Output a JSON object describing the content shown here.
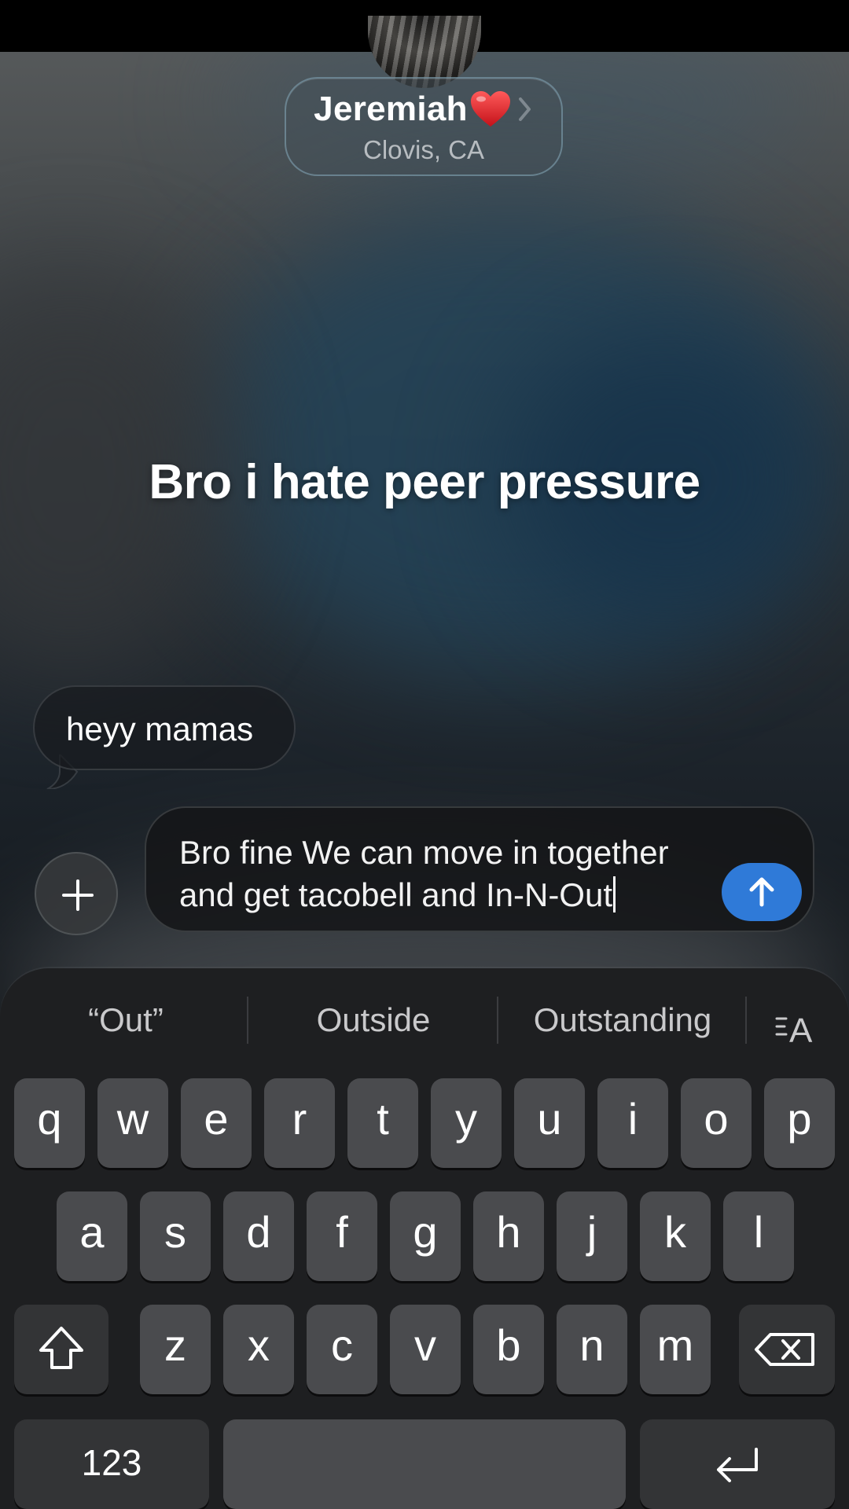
{
  "contact": {
    "name": "Jeremiah",
    "location": "Clovis, CA",
    "emoji": "heart-emoji-icon"
  },
  "conversation": {
    "effect_text": "Bro i hate peer pressure",
    "incoming_message": "heyy mamas"
  },
  "compose": {
    "line1": "Bro fine We can move in together",
    "line2": "and get tacobell and In-N-Out",
    "send_color": "#2f7ad8"
  },
  "keyboard": {
    "suggestions": [
      "“Out”",
      "Outside",
      "Outstanding"
    ],
    "row1": [
      "q",
      "w",
      "e",
      "r",
      "t",
      "y",
      "u",
      "i",
      "o",
      "p"
    ],
    "row2": [
      "a",
      "s",
      "d",
      "f",
      "g",
      "h",
      "j",
      "k",
      "l"
    ],
    "row3": [
      "z",
      "x",
      "c",
      "v",
      "b",
      "n",
      "m"
    ],
    "numbers_label": "123"
  }
}
